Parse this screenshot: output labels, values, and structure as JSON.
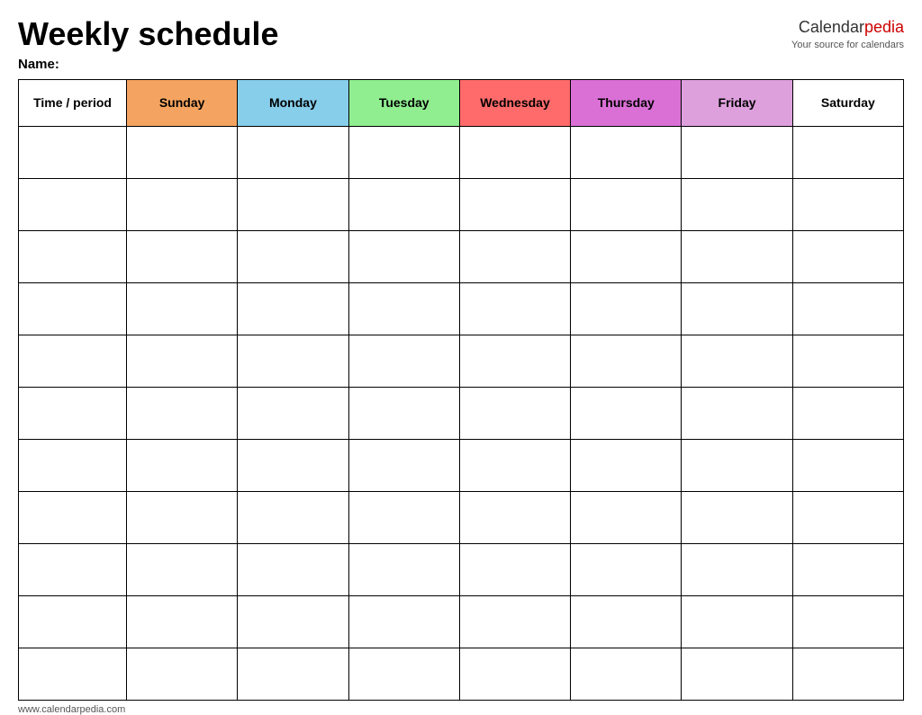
{
  "header": {
    "title": "Weekly schedule",
    "brand_name": "Calendar",
    "brand_pedia": "pedia",
    "brand_sub": "Your source for calendars",
    "name_label": "Name:"
  },
  "table": {
    "headers": [
      {
        "label": "Time / period",
        "class": "th-time"
      },
      {
        "label": "Sunday",
        "class": "th-sunday"
      },
      {
        "label": "Monday",
        "class": "th-monday"
      },
      {
        "label": "Tuesday",
        "class": "th-tuesday"
      },
      {
        "label": "Wednesday",
        "class": "th-wednesday"
      },
      {
        "label": "Thursday",
        "class": "th-thursday"
      },
      {
        "label": "Friday",
        "class": "th-friday"
      },
      {
        "label": "Saturday",
        "class": "th-saturday"
      }
    ],
    "row_count": 11
  },
  "footer": {
    "url": "www.calendarpedia.com"
  }
}
